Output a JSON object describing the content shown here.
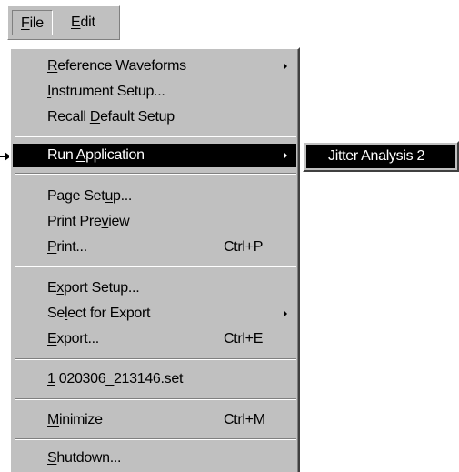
{
  "menubar": {
    "file": {
      "pre": "",
      "ul": "F",
      "post": "ile"
    },
    "edit": {
      "pre": "",
      "ul": "E",
      "post": "dit"
    }
  },
  "menu": {
    "reference_waveforms": {
      "pre": "",
      "ul": "R",
      "post": "eference Waveforms"
    },
    "instrument_setup": {
      "pre": "",
      "ul": "I",
      "post": "nstrument Setup..."
    },
    "recall_default_setup": {
      "pre": "Recall ",
      "ul": "D",
      "post": "efault Setup"
    },
    "run_application": {
      "pre": "Run ",
      "ul": "A",
      "post": "pplication"
    },
    "page_setup": {
      "pre": "Page Set",
      "ul": "u",
      "post": "p..."
    },
    "print_preview": {
      "pre": "Print Pre",
      "ul": "v",
      "post": "iew"
    },
    "print": {
      "pre": "",
      "ul": "P",
      "post": "rint...",
      "shortcut": "Ctrl+P"
    },
    "export_setup": {
      "pre": "E",
      "ul": "x",
      "post": "port Setup..."
    },
    "select_for_export": {
      "pre": "Se",
      "ul": "l",
      "post": "ect for Export"
    },
    "export": {
      "pre": "",
      "ul": "E",
      "post": "xport...",
      "shortcut": "Ctrl+E"
    },
    "recent_file": {
      "pre": "",
      "ul": "1",
      "post": " 020306_213146.set"
    },
    "minimize": {
      "pre": "",
      "ul": "M",
      "post": "inimize",
      "shortcut": "Ctrl+M"
    },
    "shutdown": {
      "pre": "",
      "ul": "S",
      "post": "hutdown..."
    }
  },
  "submenu": {
    "jitter_analysis": "Jitter Analysis 2"
  },
  "colors": {
    "menu_bg": "#c0c0c0",
    "highlight_bg": "#000000",
    "highlight_fg": "#ffffff"
  }
}
